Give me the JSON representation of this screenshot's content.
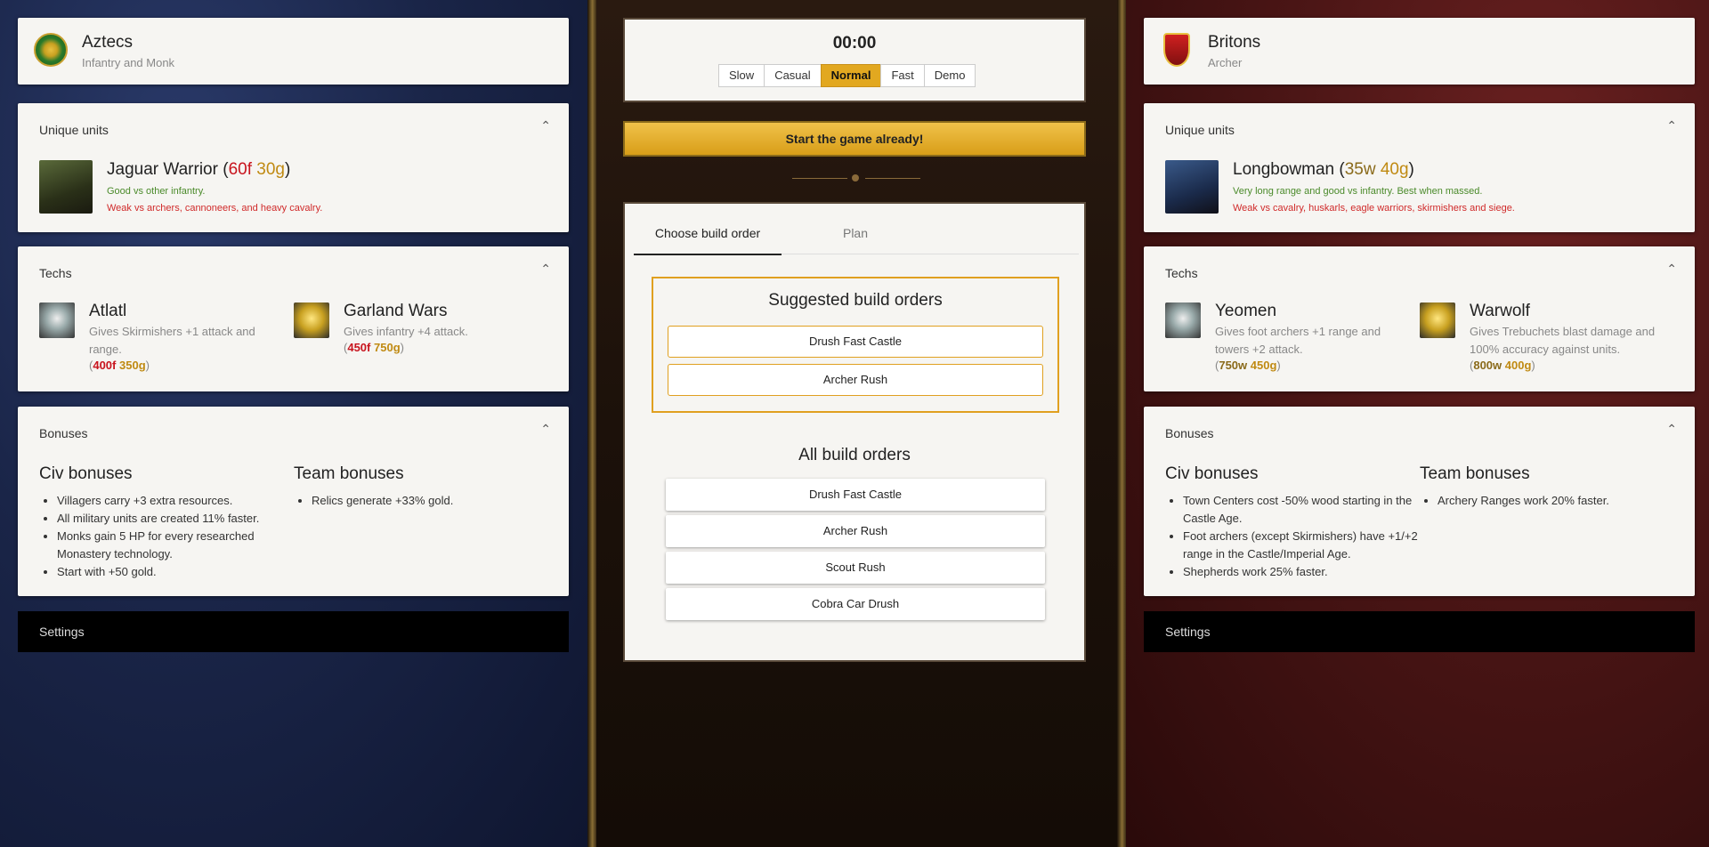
{
  "left": {
    "civ": {
      "name": "Aztecs",
      "subtitle": "Infantry and Monk"
    },
    "unique_units": {
      "title": "Unique units",
      "unit": {
        "name": "Jaguar Warrior",
        "cost_food": "60f",
        "cost_gold": "30g",
        "good": "Good vs other infantry.",
        "weak": "Weak vs archers, cannoneers, and heavy cavalry."
      }
    },
    "techs": {
      "title": "Techs",
      "items": [
        {
          "name": "Atlatl",
          "desc": "Gives Skirmishers +1 attack and range.",
          "cost_a": "400f",
          "cost_b": "350g"
        },
        {
          "name": "Garland Wars",
          "desc": "Gives infantry +4 attack.",
          "cost_a": "450f",
          "cost_b": "750g"
        }
      ]
    },
    "bonuses": {
      "title": "Bonuses",
      "civ_title": "Civ bonuses",
      "team_title": "Team bonuses",
      "civ": [
        "Villagers carry +3 extra resources.",
        "All military units are created 11% faster.",
        "Monks gain 5 HP for every researched Monastery technology.",
        "Start with +50 gold."
      ],
      "team": [
        "Relics generate +33% gold."
      ]
    },
    "settings": "Settings"
  },
  "right": {
    "civ": {
      "name": "Britons",
      "subtitle": "Archer"
    },
    "unique_units": {
      "title": "Unique units",
      "unit": {
        "name": "Longbowman",
        "cost_wood": "35w",
        "cost_gold": "40g",
        "good": "Very long range and good vs infantry. Best when massed.",
        "weak": "Weak vs cavalry, huskarls, eagle warriors, skirmishers and siege."
      }
    },
    "techs": {
      "title": "Techs",
      "items": [
        {
          "name": "Yeomen",
          "desc": "Gives foot archers +1 range and towers +2 attack.",
          "cost_a": "750w",
          "cost_b": "450g"
        },
        {
          "name": "Warwolf",
          "desc": "Gives Trebuchets blast damage and 100% accuracy against units.",
          "cost_a": "800w",
          "cost_b": "400g"
        }
      ]
    },
    "bonuses": {
      "title": "Bonuses",
      "civ_title": "Civ bonuses",
      "team_title": "Team bonuses",
      "civ": [
        "Town Centers cost -50% wood starting in the Castle Age.",
        "Foot archers (except Skirmishers) have +1/+2 range in the Castle/Imperial Age.",
        "Shepherds work 25% faster."
      ],
      "team": [
        "Archery Ranges work 20% faster."
      ]
    },
    "settings": "Settings"
  },
  "middle": {
    "timer": "00:00",
    "speeds": [
      "Slow",
      "Casual",
      "Normal",
      "Fast",
      "Demo"
    ],
    "selected_speed": "Normal",
    "start_button": "Start the game already!",
    "tabs": [
      "Choose build order",
      "Plan"
    ],
    "suggested_title": "Suggested build orders",
    "suggested": [
      "Drush Fast Castle",
      "Archer Rush"
    ],
    "all_title": "All build orders",
    "all": [
      "Drush Fast Castle",
      "Archer Rush",
      "Scout Rush",
      "Cobra Car Drush"
    ]
  },
  "colors": {
    "food": "#c8141e",
    "wood": "#8a6a1a",
    "gold": "#c08a12",
    "accent": "#e2a820",
    "good": "#4a8a2a",
    "weak": "#d02a2a"
  }
}
